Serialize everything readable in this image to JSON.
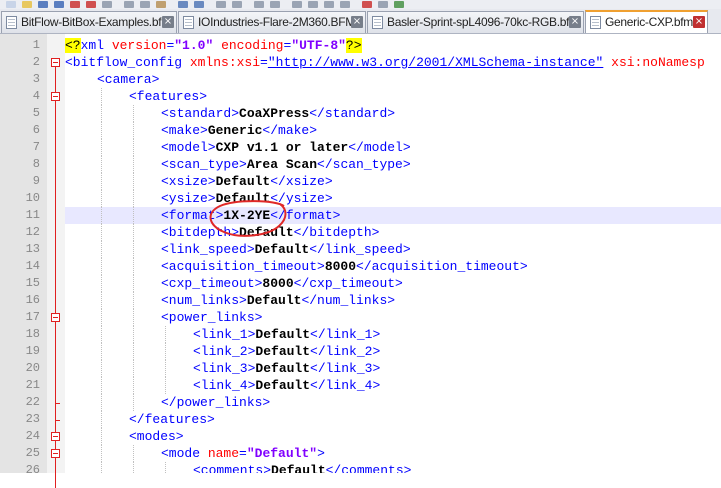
{
  "tabs": [
    {
      "label": "BitFlow-BitBox-Examples.bfml",
      "close": "×",
      "active": false
    },
    {
      "label": "IOIndustries-Flare-2M360.BFML",
      "close": "×",
      "active": false
    },
    {
      "label": "Basler-Sprint-spL4096-70kc-RGB.bfml",
      "close": "×",
      "active": false
    },
    {
      "label": "Generic-CXP.bfml",
      "close": "×",
      "active": true
    }
  ],
  "editor": {
    "current_line": 11,
    "annotation": "red hand-drawn circle around format value",
    "lines": [
      {
        "n": "1",
        "ind": 0,
        "tokens": [
          [
            "pi",
            "<?"
          ],
          [
            "tag",
            "xml "
          ],
          [
            "attr",
            "version"
          ],
          [
            "tag",
            "="
          ],
          [
            "val",
            "\"1.0\""
          ],
          [
            "tag",
            " "
          ],
          [
            "attr",
            "encoding"
          ],
          [
            "tag",
            "="
          ],
          [
            "val",
            "\"UTF-8\""
          ],
          [
            "pi",
            "?>"
          ]
        ]
      },
      {
        "n": "2",
        "ind": 0,
        "tokens": [
          [
            "tag",
            "<bitflow_config "
          ],
          [
            "attr",
            "xmlns:xsi"
          ],
          [
            "tag",
            "="
          ],
          [
            "url",
            "\"http://www.w3.org/2001/XMLSchema-instance\""
          ],
          [
            "tag",
            " "
          ],
          [
            "attr",
            "xsi:noNamesp"
          ]
        ]
      },
      {
        "n": "3",
        "ind": 1,
        "tokens": [
          [
            "tag",
            "<camera>"
          ]
        ]
      },
      {
        "n": "4",
        "ind": 2,
        "tokens": [
          [
            "tag",
            "<features>"
          ]
        ]
      },
      {
        "n": "5",
        "ind": 3,
        "tokens": [
          [
            "tag",
            "<standard>"
          ],
          [
            "txt",
            "CoaXPress"
          ],
          [
            "tag",
            "</standard>"
          ]
        ]
      },
      {
        "n": "6",
        "ind": 3,
        "tokens": [
          [
            "tag",
            "<make>"
          ],
          [
            "txt",
            "Generic"
          ],
          [
            "tag",
            "</make>"
          ]
        ]
      },
      {
        "n": "7",
        "ind": 3,
        "tokens": [
          [
            "tag",
            "<model>"
          ],
          [
            "txt",
            "CXP v1.1 or later"
          ],
          [
            "tag",
            "</model>"
          ]
        ]
      },
      {
        "n": "8",
        "ind": 3,
        "tokens": [
          [
            "tag",
            "<scan_type>"
          ],
          [
            "txt",
            "Area Scan"
          ],
          [
            "tag",
            "</scan_type>"
          ]
        ]
      },
      {
        "n": "9",
        "ind": 3,
        "tokens": [
          [
            "tag",
            "<xsize>"
          ],
          [
            "txt",
            "Default"
          ],
          [
            "tag",
            "</xsize>"
          ]
        ]
      },
      {
        "n": "10",
        "ind": 3,
        "tokens": [
          [
            "tag",
            "<ysize>"
          ],
          [
            "txt",
            "Default"
          ],
          [
            "tag",
            "</ysize>"
          ]
        ]
      },
      {
        "n": "11",
        "ind": 3,
        "tokens": [
          [
            "tag",
            "<format>"
          ],
          [
            "txt",
            "1X-2YE"
          ],
          [
            "tag",
            "</format>"
          ]
        ]
      },
      {
        "n": "12",
        "ind": 3,
        "tokens": [
          [
            "tag",
            "<bitdepth>"
          ],
          [
            "txt",
            "Default"
          ],
          [
            "tag",
            "</bitdepth>"
          ]
        ]
      },
      {
        "n": "13",
        "ind": 3,
        "tokens": [
          [
            "tag",
            "<link_speed>"
          ],
          [
            "txt",
            "Default"
          ],
          [
            "tag",
            "</link_speed>"
          ]
        ]
      },
      {
        "n": "14",
        "ind": 3,
        "tokens": [
          [
            "tag",
            "<acquisition_timeout>"
          ],
          [
            "txt",
            "8000"
          ],
          [
            "tag",
            "</acquisition_timeout>"
          ]
        ]
      },
      {
        "n": "15",
        "ind": 3,
        "tokens": [
          [
            "tag",
            "<cxp_timeout>"
          ],
          [
            "txt",
            "8000"
          ],
          [
            "tag",
            "</cxp_timeout>"
          ]
        ]
      },
      {
        "n": "16",
        "ind": 3,
        "tokens": [
          [
            "tag",
            "<num_links>"
          ],
          [
            "txt",
            "Default"
          ],
          [
            "tag",
            "</num_links>"
          ]
        ]
      },
      {
        "n": "17",
        "ind": 3,
        "tokens": [
          [
            "tag",
            "<power_links>"
          ]
        ]
      },
      {
        "n": "18",
        "ind": 4,
        "tokens": [
          [
            "tag",
            "<link_1>"
          ],
          [
            "txt",
            "Default"
          ],
          [
            "tag",
            "</link_1>"
          ]
        ]
      },
      {
        "n": "19",
        "ind": 4,
        "tokens": [
          [
            "tag",
            "<link_2>"
          ],
          [
            "txt",
            "Default"
          ],
          [
            "tag",
            "</link_2>"
          ]
        ]
      },
      {
        "n": "20",
        "ind": 4,
        "tokens": [
          [
            "tag",
            "<link_3>"
          ],
          [
            "txt",
            "Default"
          ],
          [
            "tag",
            "</link_3>"
          ]
        ]
      },
      {
        "n": "21",
        "ind": 4,
        "tokens": [
          [
            "tag",
            "<link_4>"
          ],
          [
            "txt",
            "Default"
          ],
          [
            "tag",
            "</link_4>"
          ]
        ]
      },
      {
        "n": "22",
        "ind": 3,
        "tokens": [
          [
            "tag",
            "</power_links>"
          ]
        ]
      },
      {
        "n": "23",
        "ind": 2,
        "tokens": [
          [
            "tag",
            "</features>"
          ]
        ]
      },
      {
        "n": "24",
        "ind": 2,
        "tokens": [
          [
            "tag",
            "<modes>"
          ]
        ]
      },
      {
        "n": "25",
        "ind": 3,
        "tokens": [
          [
            "tag",
            "<mode "
          ],
          [
            "attr",
            "name"
          ],
          [
            "tag",
            "="
          ],
          [
            "val",
            "\"Default\""
          ],
          [
            "tag",
            ">"
          ]
        ]
      },
      {
        "n": "26",
        "ind": 4,
        "tokens": [
          [
            "tag",
            "<comments>"
          ],
          [
            "txt",
            "Default"
          ],
          [
            "tag",
            "</comments>"
          ]
        ]
      }
    ]
  }
}
